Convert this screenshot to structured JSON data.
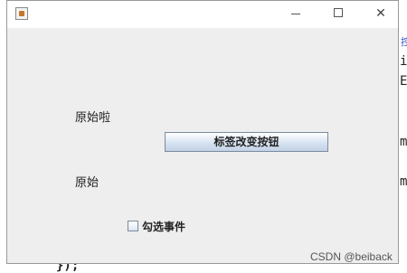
{
  "background_editor": {
    "chars": [
      "i",
      "E",
      "m",
      "m",
      "});"
    ]
  },
  "window": {
    "title_bar": {
      "minimize_symbol": "",
      "maximize_symbol": "",
      "close_symbol": "✕"
    },
    "labels": {
      "top": "原始啦",
      "middle": "原始"
    },
    "button": {
      "label": "标签改变按钮"
    },
    "checkbox": {
      "label": "勾选事件",
      "checked": false
    }
  },
  "watermark": "CSDN @beiback",
  "colors": {
    "window_bg": "#eeeeee",
    "button_gradient_bottom": "#c3d2e6"
  }
}
